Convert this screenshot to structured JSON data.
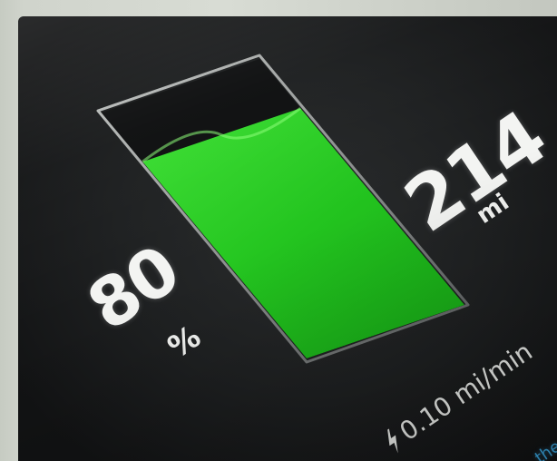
{
  "battery": {
    "percent_value": "80",
    "percent_unit": "%",
    "charge_level": 0.8,
    "fill_color": "#2fd12a",
    "empty_color": "#101112"
  },
  "range": {
    "value": "214",
    "unit": "mi"
  },
  "charging": {
    "rate": "0.10 mi/min",
    "icon": "lightning-bolt-icon"
  },
  "corner_link": {
    "partial_text": "the"
  }
}
